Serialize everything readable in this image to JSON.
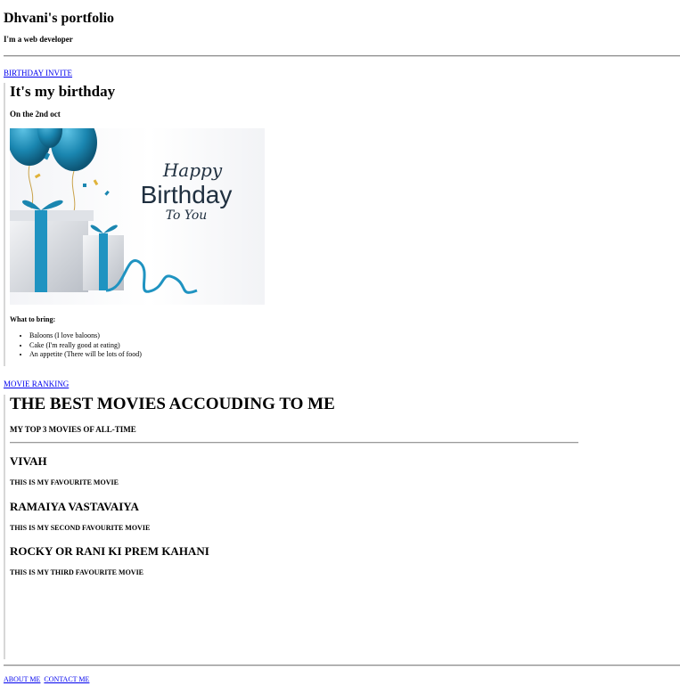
{
  "header": {
    "title": "Dhvani's portfolio",
    "tagline": "I'm a web developer"
  },
  "birthday": {
    "link_label": "BIRTHDAY INVITE",
    "heading": "It's my birthday",
    "date": "On the 2nd oct",
    "card": {
      "line1": "Happy",
      "line2": "Birthday",
      "line3": "To You",
      "accent_color": "#1d8fb8",
      "text_color": "#203040"
    },
    "bring_heading": "What to bring:",
    "bring_items": [
      "Baloons (I love baloons)",
      "Cake (I'm really good at eating)",
      "An appetite (There will be lots of food)"
    ]
  },
  "movies": {
    "link_label": "MOVIE RANKING",
    "heading": "THE BEST MOVIES ACCOUDING TO ME",
    "subheading": "MY TOP 3 MOVIES OF ALL-TIME",
    "items": [
      {
        "title": "VIVAH",
        "desc": "THIS IS MY FAVOURITE MOVIE"
      },
      {
        "title": "RAMAIYA VASTAVAIYA",
        "desc": "THIS IS MY SECOND FAVOURITE MOVIE"
      },
      {
        "title": "ROCKY OR RANI KI PREM KAHANI",
        "desc": "THIS IS MY THIRD FAVOURITE MOVIE"
      }
    ]
  },
  "footer": {
    "about_label": "ABOUT ME",
    "contact_label": "CONTACT ME"
  }
}
